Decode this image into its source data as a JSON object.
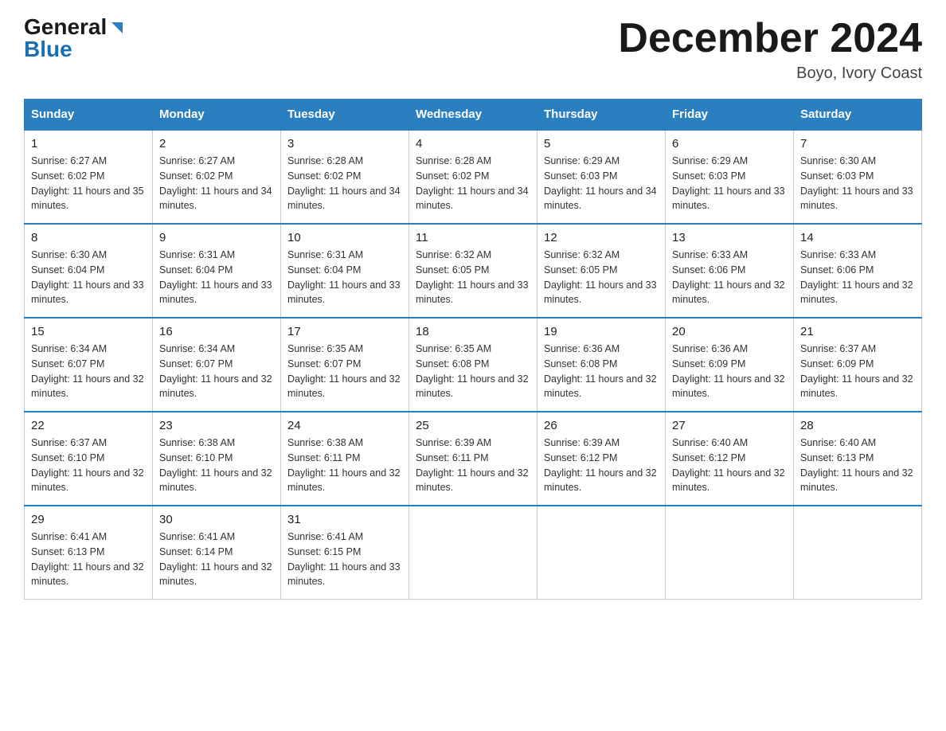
{
  "logo": {
    "general": "General",
    "blue": "Blue"
  },
  "title": {
    "month_year": "December 2024",
    "location": "Boyo, Ivory Coast"
  },
  "days_header": [
    "Sunday",
    "Monday",
    "Tuesday",
    "Wednesday",
    "Thursday",
    "Friday",
    "Saturday"
  ],
  "weeks": [
    [
      {
        "day": "1",
        "sunrise": "6:27 AM",
        "sunset": "6:02 PM",
        "daylight": "11 hours and 35 minutes."
      },
      {
        "day": "2",
        "sunrise": "6:27 AM",
        "sunset": "6:02 PM",
        "daylight": "11 hours and 34 minutes."
      },
      {
        "day": "3",
        "sunrise": "6:28 AM",
        "sunset": "6:02 PM",
        "daylight": "11 hours and 34 minutes."
      },
      {
        "day": "4",
        "sunrise": "6:28 AM",
        "sunset": "6:02 PM",
        "daylight": "11 hours and 34 minutes."
      },
      {
        "day": "5",
        "sunrise": "6:29 AM",
        "sunset": "6:03 PM",
        "daylight": "11 hours and 34 minutes."
      },
      {
        "day": "6",
        "sunrise": "6:29 AM",
        "sunset": "6:03 PM",
        "daylight": "11 hours and 33 minutes."
      },
      {
        "day": "7",
        "sunrise": "6:30 AM",
        "sunset": "6:03 PM",
        "daylight": "11 hours and 33 minutes."
      }
    ],
    [
      {
        "day": "8",
        "sunrise": "6:30 AM",
        "sunset": "6:04 PM",
        "daylight": "11 hours and 33 minutes."
      },
      {
        "day": "9",
        "sunrise": "6:31 AM",
        "sunset": "6:04 PM",
        "daylight": "11 hours and 33 minutes."
      },
      {
        "day": "10",
        "sunrise": "6:31 AM",
        "sunset": "6:04 PM",
        "daylight": "11 hours and 33 minutes."
      },
      {
        "day": "11",
        "sunrise": "6:32 AM",
        "sunset": "6:05 PM",
        "daylight": "11 hours and 33 minutes."
      },
      {
        "day": "12",
        "sunrise": "6:32 AM",
        "sunset": "6:05 PM",
        "daylight": "11 hours and 33 minutes."
      },
      {
        "day": "13",
        "sunrise": "6:33 AM",
        "sunset": "6:06 PM",
        "daylight": "11 hours and 32 minutes."
      },
      {
        "day": "14",
        "sunrise": "6:33 AM",
        "sunset": "6:06 PM",
        "daylight": "11 hours and 32 minutes."
      }
    ],
    [
      {
        "day": "15",
        "sunrise": "6:34 AM",
        "sunset": "6:07 PM",
        "daylight": "11 hours and 32 minutes."
      },
      {
        "day": "16",
        "sunrise": "6:34 AM",
        "sunset": "6:07 PM",
        "daylight": "11 hours and 32 minutes."
      },
      {
        "day": "17",
        "sunrise": "6:35 AM",
        "sunset": "6:07 PM",
        "daylight": "11 hours and 32 minutes."
      },
      {
        "day": "18",
        "sunrise": "6:35 AM",
        "sunset": "6:08 PM",
        "daylight": "11 hours and 32 minutes."
      },
      {
        "day": "19",
        "sunrise": "6:36 AM",
        "sunset": "6:08 PM",
        "daylight": "11 hours and 32 minutes."
      },
      {
        "day": "20",
        "sunrise": "6:36 AM",
        "sunset": "6:09 PM",
        "daylight": "11 hours and 32 minutes."
      },
      {
        "day": "21",
        "sunrise": "6:37 AM",
        "sunset": "6:09 PM",
        "daylight": "11 hours and 32 minutes."
      }
    ],
    [
      {
        "day": "22",
        "sunrise": "6:37 AM",
        "sunset": "6:10 PM",
        "daylight": "11 hours and 32 minutes."
      },
      {
        "day": "23",
        "sunrise": "6:38 AM",
        "sunset": "6:10 PM",
        "daylight": "11 hours and 32 minutes."
      },
      {
        "day": "24",
        "sunrise": "6:38 AM",
        "sunset": "6:11 PM",
        "daylight": "11 hours and 32 minutes."
      },
      {
        "day": "25",
        "sunrise": "6:39 AM",
        "sunset": "6:11 PM",
        "daylight": "11 hours and 32 minutes."
      },
      {
        "day": "26",
        "sunrise": "6:39 AM",
        "sunset": "6:12 PM",
        "daylight": "11 hours and 32 minutes."
      },
      {
        "day": "27",
        "sunrise": "6:40 AM",
        "sunset": "6:12 PM",
        "daylight": "11 hours and 32 minutes."
      },
      {
        "day": "28",
        "sunrise": "6:40 AM",
        "sunset": "6:13 PM",
        "daylight": "11 hours and 32 minutes."
      }
    ],
    [
      {
        "day": "29",
        "sunrise": "6:41 AM",
        "sunset": "6:13 PM",
        "daylight": "11 hours and 32 minutes."
      },
      {
        "day": "30",
        "sunrise": "6:41 AM",
        "sunset": "6:14 PM",
        "daylight": "11 hours and 32 minutes."
      },
      {
        "day": "31",
        "sunrise": "6:41 AM",
        "sunset": "6:15 PM",
        "daylight": "11 hours and 33 minutes."
      },
      null,
      null,
      null,
      null
    ]
  ]
}
